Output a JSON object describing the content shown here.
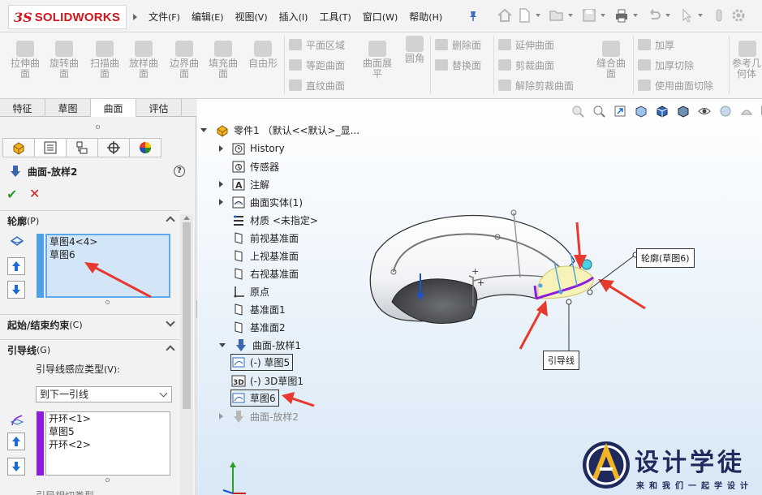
{
  "app": {
    "brand_prefix": "3S",
    "brand_name": "SOLIDWORKS"
  },
  "menu": [
    {
      "label": "文件",
      "key": "(F)"
    },
    {
      "label": "编辑",
      "key": "(E)"
    },
    {
      "label": "视图",
      "key": "(V)"
    },
    {
      "label": "插入",
      "key": "(I)"
    },
    {
      "label": "工具",
      "key": "(T)"
    },
    {
      "label": "窗口",
      "key": "(W)"
    },
    {
      "label": "帮助",
      "key": "(H)"
    }
  ],
  "toolbar": {
    "big": [
      {
        "l1": "拉伸曲",
        "l2": "面"
      },
      {
        "l1": "旋转曲",
        "l2": "面"
      },
      {
        "l1": "扫描曲",
        "l2": "面"
      },
      {
        "l1": "放样曲",
        "l2": "面"
      },
      {
        "l1": "边界曲",
        "l2": "面"
      },
      {
        "l1": "填充曲",
        "l2": "面"
      },
      {
        "l1": "自由形",
        "l2": ""
      }
    ],
    "col1": [
      "平面区域",
      "等距曲面",
      "直纹曲面"
    ],
    "flatten": {
      "l1": "曲面展",
      "l2": "平"
    },
    "fillet": "圆角",
    "col2": [
      "删除面",
      "替换面"
    ],
    "col3": [
      "延伸曲面",
      "剪裁曲面",
      "解除剪裁曲面"
    ],
    "knit": {
      "l1": "缝合曲",
      "l2": "面"
    },
    "col4": [
      "加厚",
      "加厚切除",
      "使用曲面切除"
    ],
    "ref": {
      "l1": "参考几",
      "l2": "何体"
    }
  },
  "tabs": [
    "特征",
    "草图",
    "曲面",
    "评估"
  ],
  "active_tab": "曲面",
  "property_manager": {
    "feature_title": "曲面-放样2",
    "profiles": {
      "header": "轮廓",
      "key": "(P)",
      "items": [
        "草图4<4>",
        "草图6"
      ]
    },
    "start_end": {
      "header": "起始/结束约束",
      "key": "(C)"
    },
    "guides": {
      "header": "引导线",
      "key": "(G)",
      "influence_label": "引导线感应类型",
      "influence_key": "(V):",
      "influence_value": "到下一引线",
      "items": [
        "开环<1>",
        "草图5",
        "开环<2>"
      ]
    },
    "bottom_cut": "引导相切类型"
  },
  "tree": {
    "part": "零件1 （默认<<默认>_显...",
    "items": [
      "History",
      "传感器",
      "注解",
      "曲面实体(1)",
      "材质 <未指定>",
      "前视基准面",
      "上视基准面",
      "右视基准面",
      "原点",
      "基准面1",
      "基准面2",
      "曲面-放样1",
      "(-) 草图5",
      "(-) 3D草图1",
      "草图6",
      "曲面-放样2"
    ]
  },
  "callouts": {
    "profile": "轮廓(草图6)",
    "guide": "引导线"
  },
  "watermark": {
    "title": "设计学徒",
    "subtitle": "来和我们一起学设计"
  },
  "colors": {
    "accent_red": "#d3151d",
    "profile_bar": "#4ea1e8",
    "guide_bar": "#8c1ce0",
    "arrow_red": "#e8392e"
  }
}
